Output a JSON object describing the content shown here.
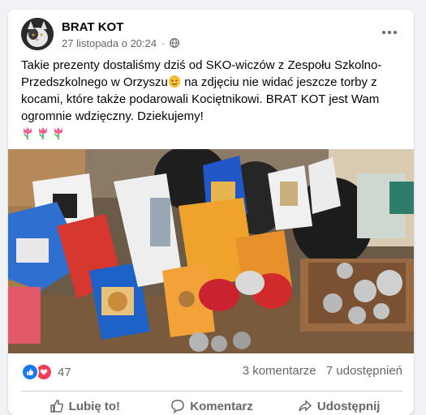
{
  "post": {
    "author": "BRAT KOT",
    "timestamp": "27 listopada o 20:24",
    "separator": "·",
    "audience_icon": "globe-icon",
    "more_icon": "more-options-icon",
    "text_part1": "Takie prezenty dostaliśmy dziś od SKO-wiczów z Zespołu Szkolno-Przedszkolnego w Orzyszu",
    "emoji": "wink-emoji",
    "text_part2": " na zdjęciu nie widać jeszcze torby z kocami, które także podarowali Kociętnikowi. BRAT KOT jest Wam ogromnie wdzięczny. Dziekujemy!",
    "tulip_emojis": [
      "tulip-emoji",
      "tulip-emoji",
      "tulip-emoji"
    ]
  },
  "stats": {
    "reaction_count": "47",
    "comments": "3 komentarze",
    "shares": "7 udostępnień"
  },
  "actions": {
    "like": "Lubię to!",
    "comment": "Komentarz",
    "share": "Udostępnij"
  },
  "colors": {
    "brand_blue": "#1877f2",
    "love_red": "#f33e58",
    "secondary_text": "#65676b"
  }
}
